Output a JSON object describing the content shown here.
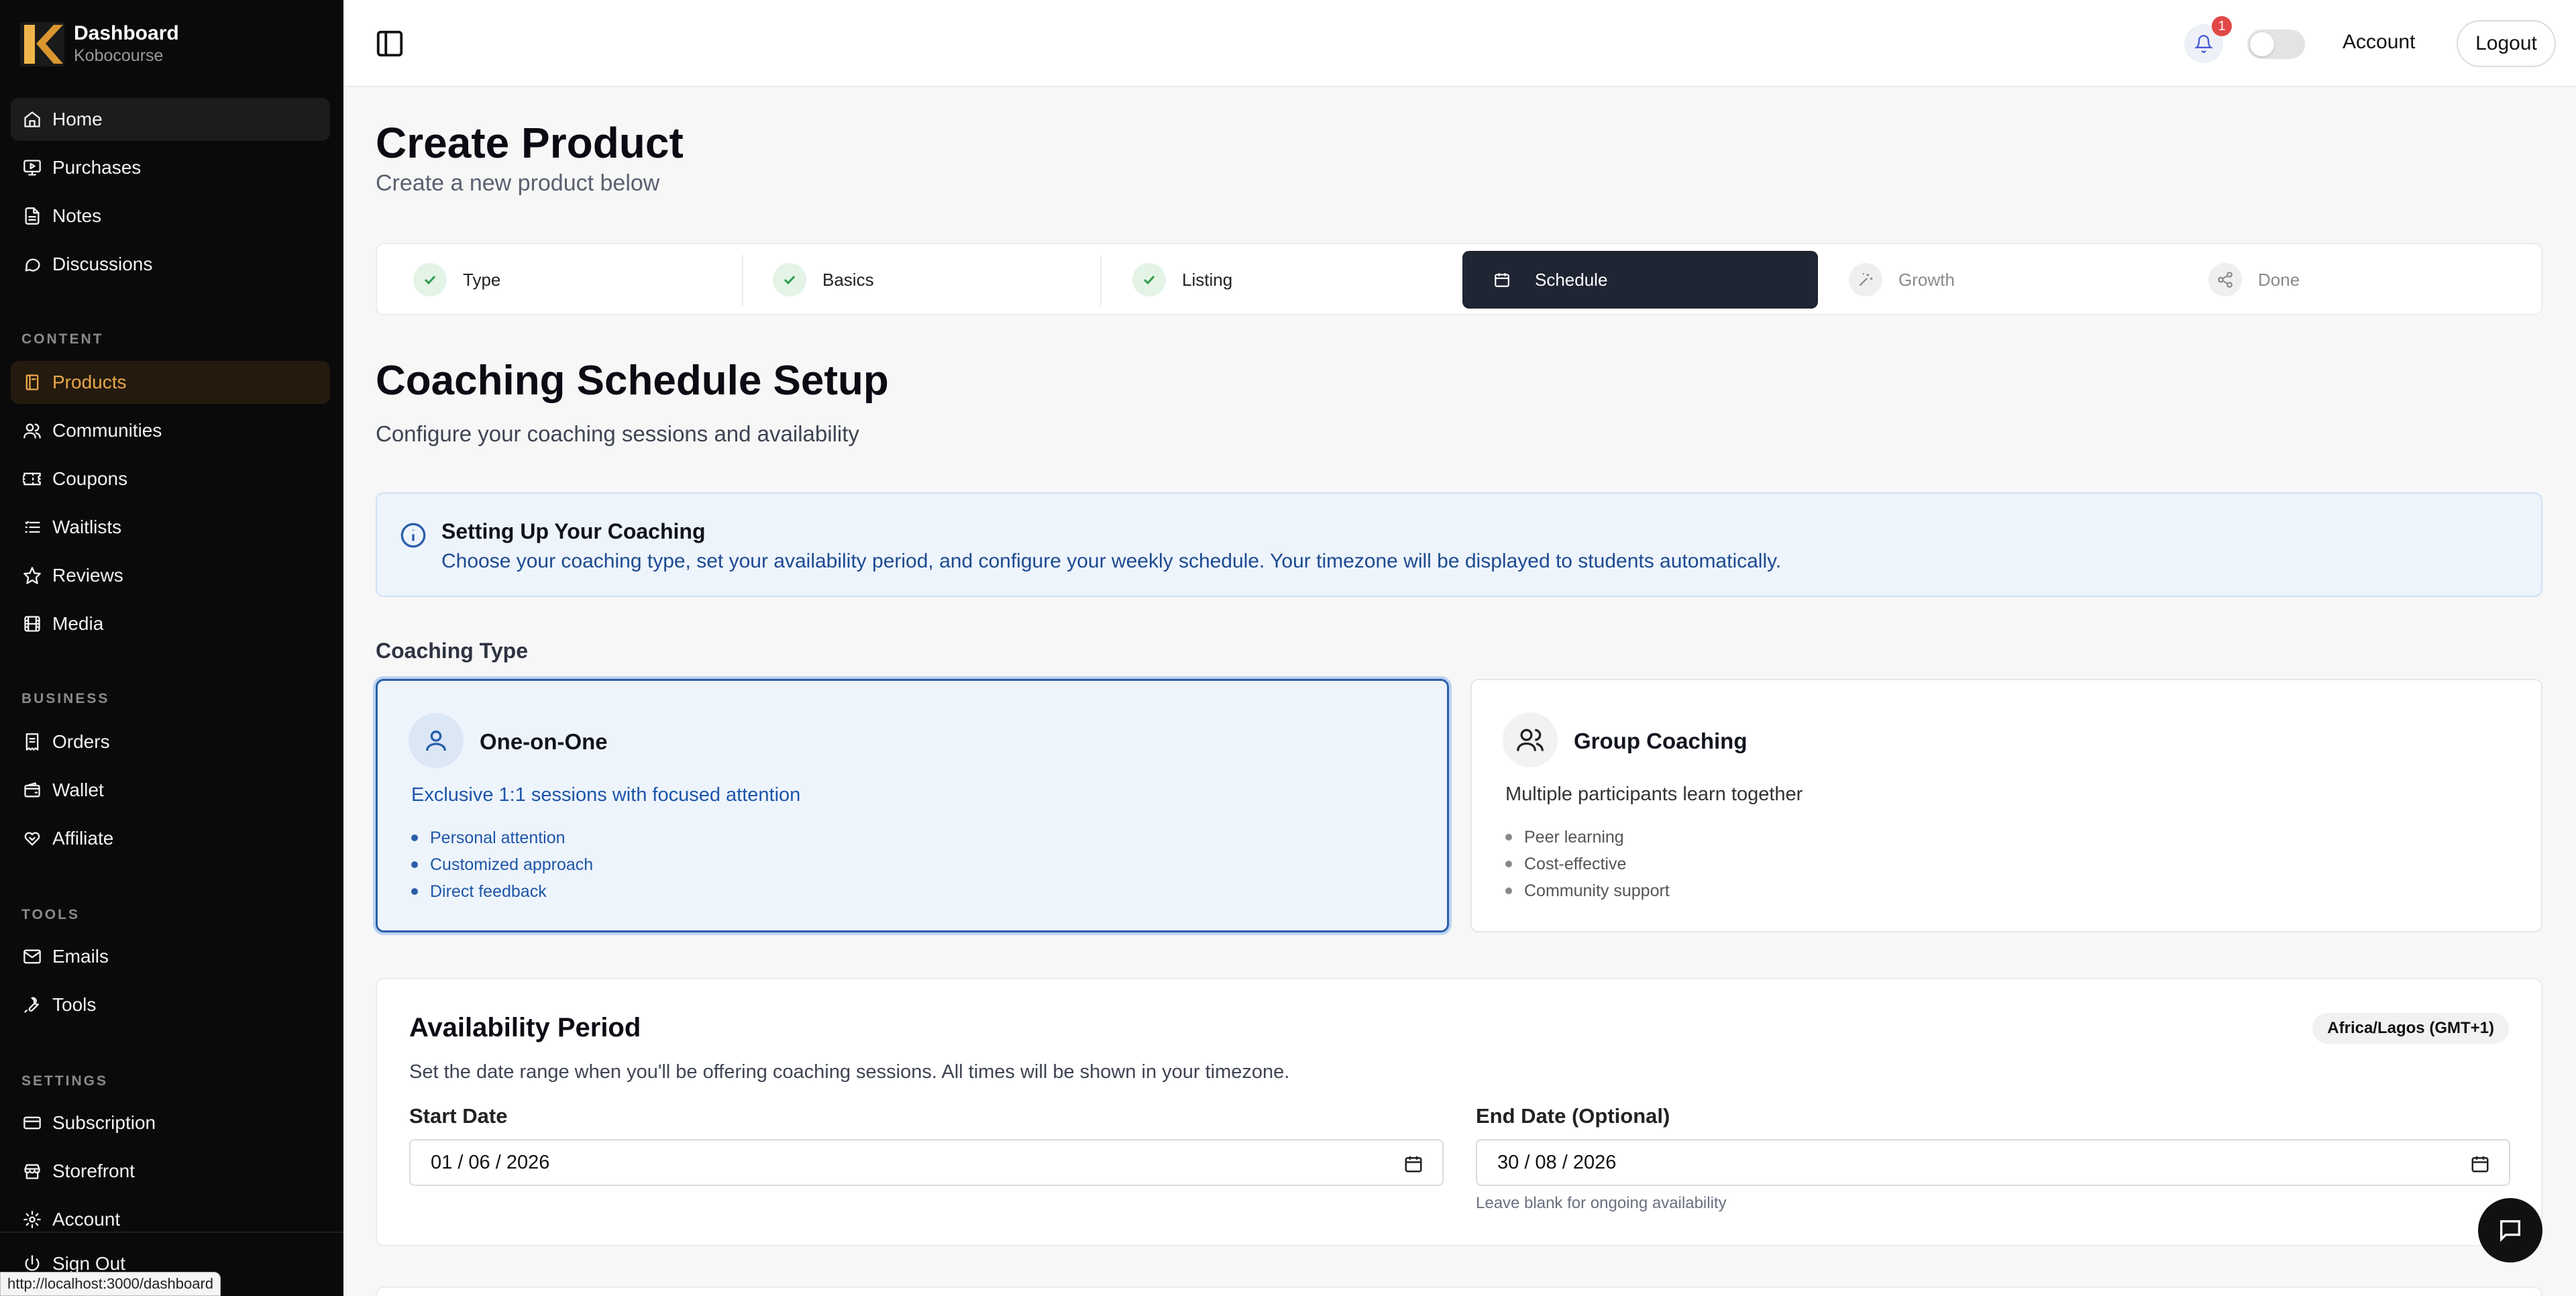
{
  "brand": {
    "title": "Dashboard",
    "subtitle": "Kobocourse",
    "logo_colors": [
      "#f0b54a",
      "#c98a2a"
    ]
  },
  "sidebar": {
    "items_main": [
      {
        "label": "Home",
        "icon": "home-icon"
      },
      {
        "label": "Purchases",
        "icon": "monitor-play-icon"
      },
      {
        "label": "Notes",
        "icon": "file-text-icon"
      },
      {
        "label": "Discussions",
        "icon": "message-circle-icon"
      }
    ],
    "section_content": "CONTENT",
    "items_content": [
      {
        "label": "Products",
        "icon": "book-icon"
      },
      {
        "label": "Communities",
        "icon": "users-icon"
      },
      {
        "label": "Coupons",
        "icon": "ticket-icon"
      },
      {
        "label": "Waitlists",
        "icon": "list-icon"
      },
      {
        "label": "Reviews",
        "icon": "star-icon"
      },
      {
        "label": "Media",
        "icon": "film-icon"
      }
    ],
    "section_business": "BUSINESS",
    "items_business": [
      {
        "label": "Orders",
        "icon": "receipt-icon"
      },
      {
        "label": "Wallet",
        "icon": "wallet-icon"
      },
      {
        "label": "Affiliate",
        "icon": "handshake-icon"
      }
    ],
    "section_tools": "TOOLS",
    "items_tools": [
      {
        "label": "Emails",
        "icon": "mail-icon"
      },
      {
        "label": "Tools",
        "icon": "wrench-icon"
      }
    ],
    "section_settings": "SETTINGS",
    "items_settings": [
      {
        "label": "Subscription",
        "icon": "credit-card-icon"
      },
      {
        "label": "Storefront",
        "icon": "store-icon"
      },
      {
        "label": "Account",
        "icon": "gear-icon"
      },
      {
        "label": "Sign Out",
        "icon": "power-icon"
      }
    ],
    "active_color": "#e8a84a"
  },
  "status_url": "http://localhost:3000/dashboard",
  "topbar": {
    "notification_count": "1",
    "account_label": "Account",
    "logout_label": "Logout"
  },
  "page": {
    "title": "Create Product",
    "subtitle": "Create a new product below"
  },
  "stepper": {
    "steps": [
      {
        "label": "Type",
        "state": "done"
      },
      {
        "label": "Basics",
        "state": "done"
      },
      {
        "label": "Listing",
        "state": "done"
      },
      {
        "label": "Schedule",
        "state": "active"
      },
      {
        "label": "Growth",
        "state": "pending"
      },
      {
        "label": "Done",
        "state": "pending"
      }
    ]
  },
  "schedule": {
    "title": "Coaching Schedule Setup",
    "subtitle": "Configure your coaching sessions and availability",
    "info_title": "Setting Up Your Coaching",
    "info_text": "Choose your coaching type, set your availability period, and configure your weekly schedule. Your timezone will be displayed to students automatically.",
    "coaching_type_label": "Coaching Type",
    "options": [
      {
        "title": "One-on-One",
        "description": "Exclusive 1:1 sessions with focused attention",
        "features": [
          "Personal attention",
          "Customized approach",
          "Direct feedback"
        ],
        "selected": true
      },
      {
        "title": "Group Coaching",
        "description": "Multiple participants learn together",
        "features": [
          "Peer learning",
          "Cost-effective",
          "Community support"
        ],
        "selected": false
      }
    ]
  },
  "availability": {
    "title": "Availability Period",
    "timezone": "Africa/Lagos (GMT+1)",
    "subtitle": "Set the date range when you'll be offering coaching sessions. All times will be shown in your timezone.",
    "start_label": "Start Date",
    "start_value": "01 / 06 / 2026",
    "end_label": "End Date (Optional)",
    "end_value": "30 / 08 / 2026",
    "end_help": "Leave blank for ongoing availability"
  }
}
